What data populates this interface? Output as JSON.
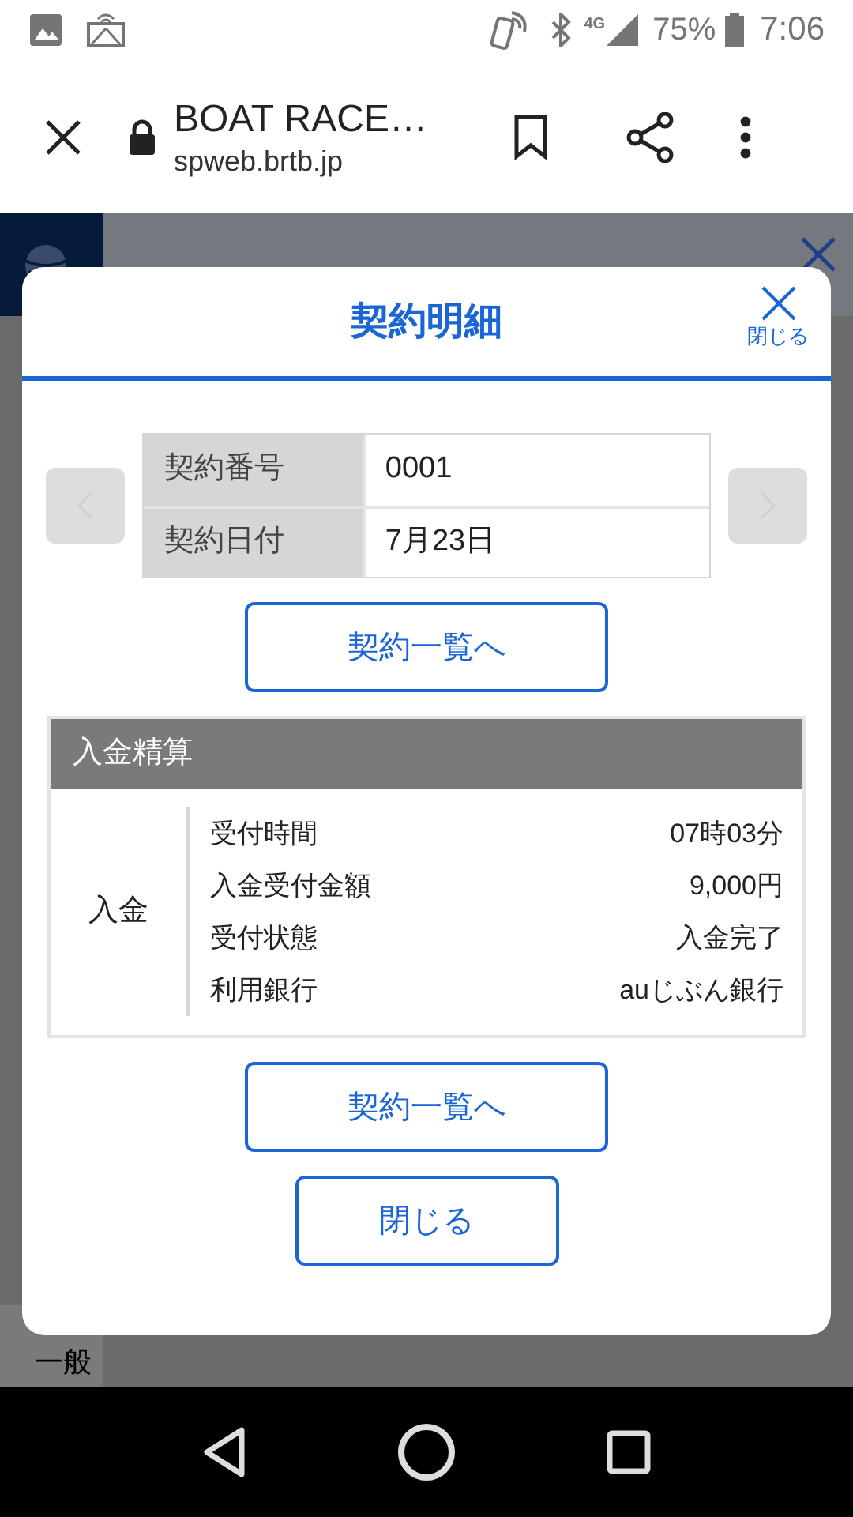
{
  "status_bar": {
    "network": "4G",
    "battery": "75%",
    "time": "7:06"
  },
  "browser": {
    "title": "BOAT RACE…",
    "url": "spweb.brtb.jp"
  },
  "background_page": {
    "row_label": "一般"
  },
  "modal": {
    "title": "契約明細",
    "close_label": "閉じる",
    "pager": {
      "prev_disabled": true,
      "next_disabled": true
    },
    "contract": [
      {
        "label": "契約番号",
        "value": "0001"
      },
      {
        "label": "契約日付",
        "value": "7月23日"
      }
    ],
    "list_button": "契約一覧へ",
    "section": {
      "title": "入金精算",
      "category": "入金",
      "rows": [
        {
          "label": "受付時間",
          "value": "07時03分"
        },
        {
          "label": "入金受付金額",
          "value": "9,000円"
        },
        {
          "label": "受付状態",
          "value": "入金完了"
        },
        {
          "label": "利用銀行",
          "value": "auじぶん銀行"
        }
      ]
    },
    "footer_buttons": [
      {
        "label": "契約一覧へ",
        "kind": "wide"
      },
      {
        "label": "閉じる",
        "kind": "narrow"
      }
    ]
  }
}
